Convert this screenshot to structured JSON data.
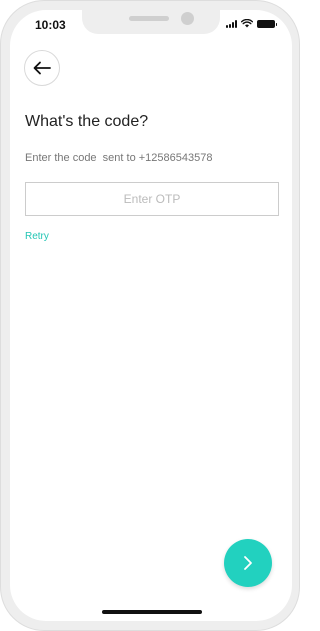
{
  "status_bar": {
    "time": "10:03"
  },
  "header": {
    "back_icon": "arrow-left-icon"
  },
  "main": {
    "title": "What's the code?",
    "subtitle": "Enter the code  sent to +12586543578",
    "otp_input": {
      "value": "",
      "placeholder": "Enter OTP"
    },
    "retry_label": "Retry"
  },
  "footer": {
    "next_icon": "chevron-right-icon"
  },
  "colors": {
    "accent": "#22d1bf",
    "link": "#22c5b4",
    "title": "#222222",
    "subtitle": "#777777"
  }
}
